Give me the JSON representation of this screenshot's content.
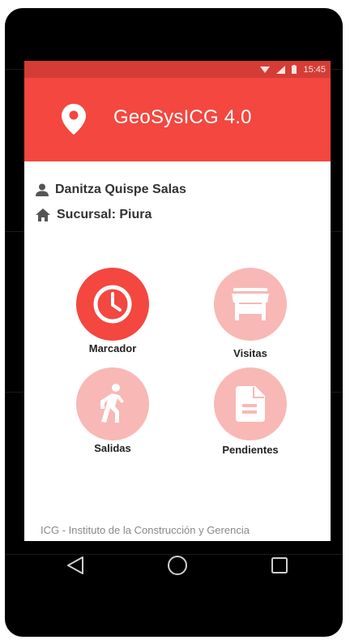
{
  "status_bar": {
    "time": "15:45",
    "icons": [
      "wifi-icon",
      "signal-icon",
      "battery-icon"
    ]
  },
  "app_bar": {
    "title": "GeoSysICG 4.0",
    "icon": "location-pin-icon"
  },
  "user": {
    "name": "Danitza Quispe Salas",
    "branch": "Sucursal: Piura"
  },
  "menu": [
    {
      "label": "Marcador",
      "icon": "clock-icon",
      "state": "active"
    },
    {
      "label": "Visitas",
      "icon": "store-icon",
      "state": "inactive"
    },
    {
      "label": "Salidas",
      "icon": "walking-person-icon",
      "state": "inactive"
    },
    {
      "label": "Pendientes",
      "icon": "document-icon",
      "state": "inactive"
    }
  ],
  "footer": {
    "text": "ICG - Instituto de la Construcción y Gerencia"
  },
  "nav": {
    "buttons": [
      "back-icon",
      "home-icon",
      "recents-icon"
    ]
  },
  "colors": {
    "primary": "#f3473f",
    "primary_dark": "#d43d36",
    "primary_light": "#f8b8b5"
  }
}
